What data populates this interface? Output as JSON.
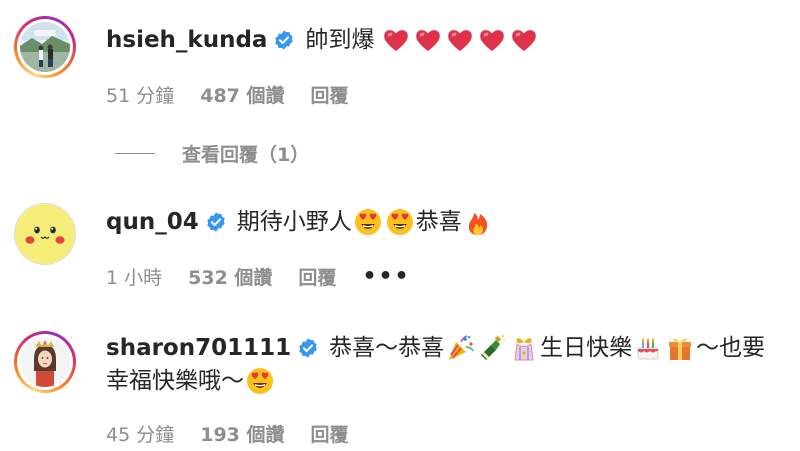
{
  "comments": [
    {
      "username": "hsieh_kunda",
      "text_parts": [
        "帥到爆"
      ],
      "time": "51 分鐘",
      "likes": "487 個讚",
      "reply": "回覆",
      "avatar_icon": "travel-photo-avatar",
      "emojis": [
        "red-heart",
        "red-heart",
        "red-heart",
        "red-heart",
        "red-heart"
      ]
    },
    {
      "username": "qun_04",
      "text_parts": [
        "期待小野人",
        "恭喜"
      ],
      "time": "1 小時",
      "likes": "532 個讚",
      "reply": "回覆",
      "more": "•••",
      "avatar_icon": "pikachu-avatar",
      "emojis": [
        "heart-eyes-face",
        "heart-eyes-face",
        "fire"
      ]
    },
    {
      "username": "sharon701111",
      "text_parts": [
        "恭喜～恭喜",
        "生日快樂",
        "～也要",
        "幸福快樂哦～"
      ],
      "time": "45 分鐘",
      "likes": "193 個讚",
      "reply": "回覆",
      "avatar_icon": "crowned-woman-avatar",
      "emojis": [
        "party-popper",
        "champagne-bottle",
        "wrapped-gift-ribbon",
        "birthday-cake",
        "gift-box",
        "heart-eyes-face"
      ]
    }
  ],
  "view_replies": {
    "label": "查看回覆（1）"
  },
  "colors": {
    "primary_text": "#262626",
    "secondary_text": "#8e8e8e",
    "verified_blue": "#3897f0",
    "heart_red": "#e0314b"
  }
}
